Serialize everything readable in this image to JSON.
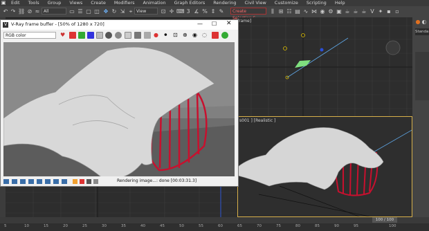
{
  "menubar": {
    "items": [
      "Edit",
      "Tools",
      "Group",
      "Views",
      "Create",
      "Modifiers",
      "Animation",
      "Graph Editors",
      "Rendering",
      "Civil View",
      "Customize",
      "Scripting",
      "Help"
    ]
  },
  "toolbar": {
    "filter_select": "All",
    "view_select": "View",
    "selection_set": "Create Selection S"
  },
  "vfb": {
    "title": "V-Ray frame buffer - [50% of 1280 x 720]",
    "channel_select": "RGB color",
    "status_text": "Rendering image...: done [00:03:31.3]"
  },
  "viewports": {
    "top_label": "frame]",
    "perspective_label": "s001 ] [Realistic ]"
  },
  "command_panel": {
    "tab_label": "Standa"
  },
  "timeline": {
    "frame_counter": "100 / 100",
    "ticks": [
      "5",
      "10",
      "15",
      "20",
      "25",
      "30",
      "35",
      "40",
      "45",
      "50",
      "55",
      "60",
      "65",
      "70",
      "75",
      "80",
      "85",
      "90",
      "95",
      "100"
    ]
  },
  "colors": {
    "accent_yellow": "#d8b04a",
    "cloth": "#d9d9d9",
    "cage": "#c8102e"
  }
}
